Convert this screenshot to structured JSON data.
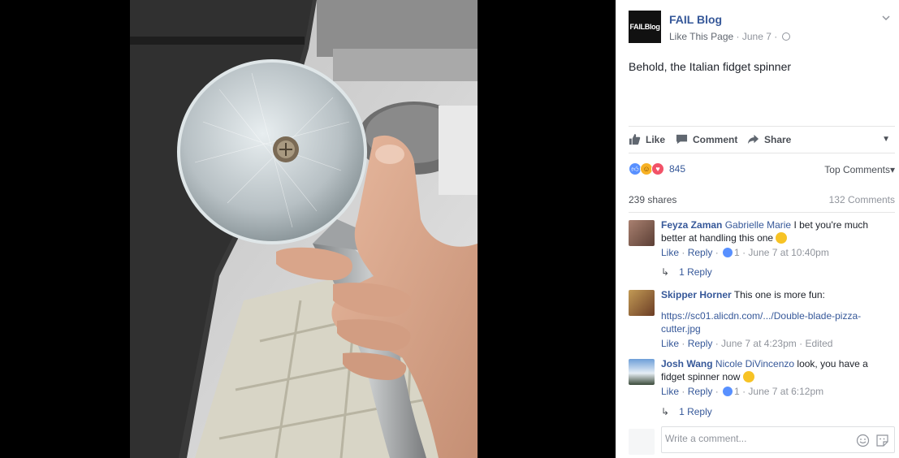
{
  "post": {
    "page_name": "FAIL Blog",
    "avatar_text": "FAILBlog",
    "like_page": "Like This Page",
    "date": "June 7",
    "caption": "Behold, the Italian fidget spinner"
  },
  "actions": {
    "like": "Like",
    "comment": "Comment",
    "share": "Share"
  },
  "stats": {
    "reaction_count": "845",
    "top_comments": "Top Comments",
    "shares": "239 shares",
    "comments": "132 Comments"
  },
  "comments": [
    {
      "author": "Feyza Zaman",
      "tag": "Gabrielle Marie",
      "text": "I bet you're much better at handling this one",
      "like": "Like",
      "reply": "Reply",
      "likes": "1",
      "time": "June 7 at 10:40pm",
      "replies": "1 Reply"
    },
    {
      "author": "Skipper Horner",
      "text": "This one is more fun:",
      "url": "https://sc01.alicdn.com/.../Double-blade-pizza-cutter.jpg",
      "like": "Like",
      "reply": "Reply",
      "time": "June 7 at 4:23pm",
      "edited": "Edited"
    },
    {
      "author": "Josh Wang",
      "tag": "Nicole DiVincenzo",
      "text": "look, you have a fidget spinner now",
      "like": "Like",
      "reply": "Reply",
      "likes": "1",
      "time": "June 7 at 6:12pm",
      "replies": "1 Reply"
    }
  ],
  "composer": {
    "placeholder": "Write a comment..."
  },
  "colors": {
    "link": "#365899",
    "like_blue": "#5890ff",
    "love_red": "#f25268",
    "haha_yellow": "#f7b125"
  }
}
